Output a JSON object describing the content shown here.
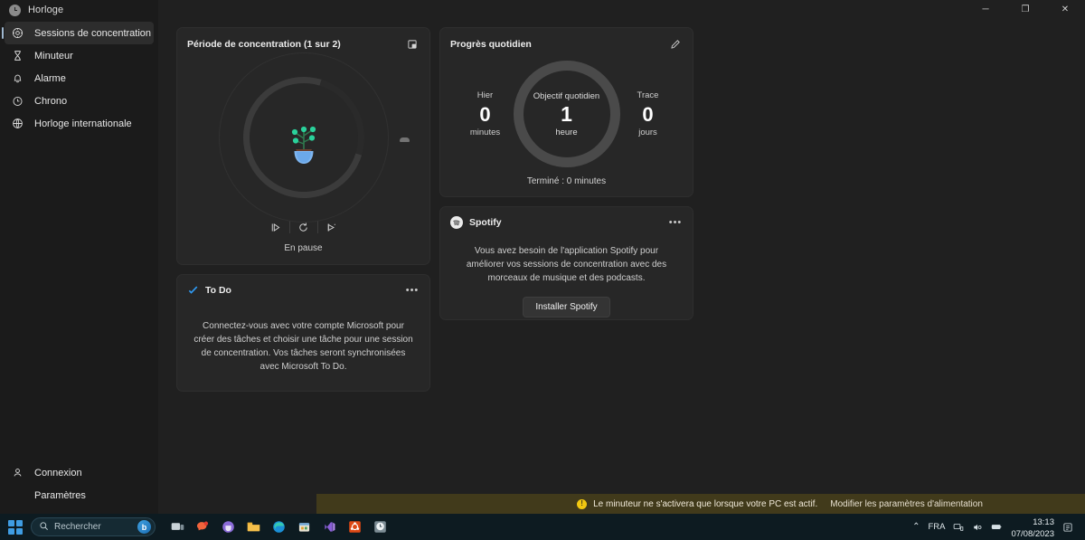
{
  "window": {
    "title": "Horloge",
    "icon": "clock-icon",
    "minimize_label": "─",
    "maximize_label": "❐",
    "close_label": "✕"
  },
  "sidebar": {
    "items": [
      {
        "label": "Sessions de concentration",
        "icon": "focus-session-icon",
        "active": true
      },
      {
        "label": "Minuteur",
        "icon": "hourglass-icon",
        "active": false
      },
      {
        "label": "Alarme",
        "icon": "bell-icon",
        "active": false
      },
      {
        "label": "Chrono",
        "icon": "stopwatch-icon",
        "active": false
      },
      {
        "label": "Horloge internationale",
        "icon": "globe-clock-icon",
        "active": false
      }
    ],
    "bottom_items": [
      {
        "label": "Connexion",
        "icon": "person-icon"
      },
      {
        "label": "Paramètres",
        "icon": "settings-icon"
      }
    ]
  },
  "focus_card": {
    "title": "Période de concentration (1 sur 2)",
    "expand_icon": "expand-icon",
    "status": "En pause",
    "controls": [
      {
        "name": "play-button",
        "icon": "play-icon"
      },
      {
        "name": "restart-button",
        "icon": "restart-icon"
      },
      {
        "name": "skip-button",
        "icon": "skip-icon"
      }
    ]
  },
  "todo_card": {
    "title": "To Do",
    "logo": "microsoft-todo-icon",
    "more_label": "•••",
    "body": "Connectez-vous avec votre compte Microsoft pour créer des tâches et choisir une tâche pour une session de concentration. Vos tâches seront synchronisées avec Microsoft To Do."
  },
  "progress_card": {
    "title": "Progrès quotidien",
    "edit_icon": "pencil-icon",
    "yesterday": {
      "label": "Hier",
      "value": "0",
      "unit": "minutes"
    },
    "goal": {
      "label": "Objectif quotidien",
      "value": "1",
      "unit": "heure"
    },
    "streak": {
      "label": "Trace",
      "value": "0",
      "unit": "jours"
    },
    "footer": "Terminé : 0 minutes"
  },
  "spotify_card": {
    "title": "Spotify",
    "logo": "spotify-icon",
    "more_label": "•••",
    "body": "Vous avez besoin de l'application Spotify pour améliorer vos sessions de concentration avec des morceaux de musique et des podcasts.",
    "install_button": "Installer Spotify"
  },
  "banner": {
    "icon": "warning-icon",
    "icon_glyph": "!",
    "text": "Le minuteur ne s'activera que lorsque votre PC est actif.",
    "link": "Modifier les paramètres d'alimentation"
  },
  "taskbar": {
    "start_label": "start-button",
    "search": {
      "placeholder": "Rechercher",
      "icon": "search-icon",
      "copilot_label": "b"
    },
    "apps": [
      {
        "name": "task-view-icon"
      },
      {
        "name": "chat-icon"
      },
      {
        "name": "teams-icon"
      },
      {
        "name": "file-explorer-icon"
      },
      {
        "name": "edge-icon"
      },
      {
        "name": "store-icon"
      },
      {
        "name": "vs-code-icon"
      },
      {
        "name": "ubuntu-icon"
      },
      {
        "name": "clock-app-icon"
      }
    ],
    "tray": {
      "chevron": "⌃",
      "language": "FRA",
      "network_icon": "network-icon",
      "sound_icon": "sound-icon",
      "battery_icon": "battery-icon",
      "time": "13:13",
      "date": "07/08/2023",
      "notification_icon": "notification-icon"
    }
  },
  "colors": {
    "window_bg": "#202020",
    "sidebar_bg": "#1b1b1b",
    "card_bg": "#272727",
    "accent": "#9fb7cf",
    "banner_bg": "#413a1b",
    "warning": "#f2c811",
    "taskbar_bg": "#0d1b21"
  }
}
